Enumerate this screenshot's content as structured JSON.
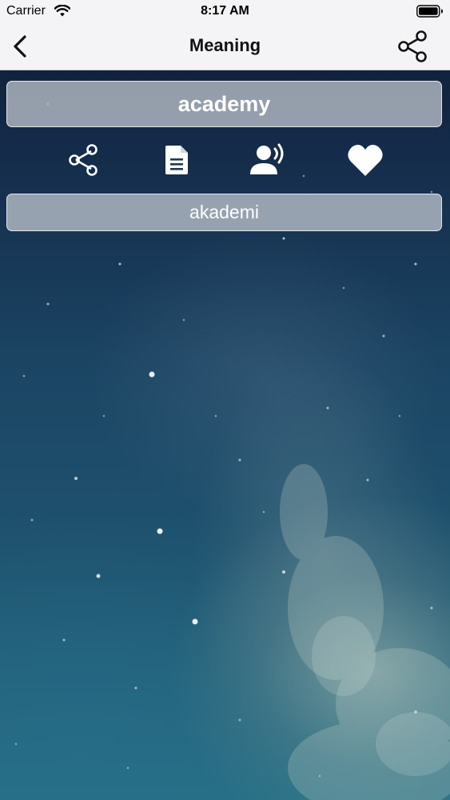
{
  "status_bar": {
    "carrier": "Carrier",
    "time": "8:17 AM",
    "wifi_icon": "wifi-icon",
    "battery_icon": "battery-icon"
  },
  "nav_bar": {
    "title": "Meaning",
    "back_icon": "chevron-left-icon",
    "share_icon": "share-icon"
  },
  "word": {
    "text": "academy"
  },
  "actions": {
    "share_icon": "share-icon",
    "document_icon": "document-icon",
    "speak_icon": "speaker-voice-icon",
    "favorite_icon": "heart-icon"
  },
  "meaning": {
    "text": "akademi"
  },
  "colors": {
    "bar_background": "#f4f4f6",
    "box_background": "#c8cdd4",
    "icon_color": "#ffffff"
  }
}
